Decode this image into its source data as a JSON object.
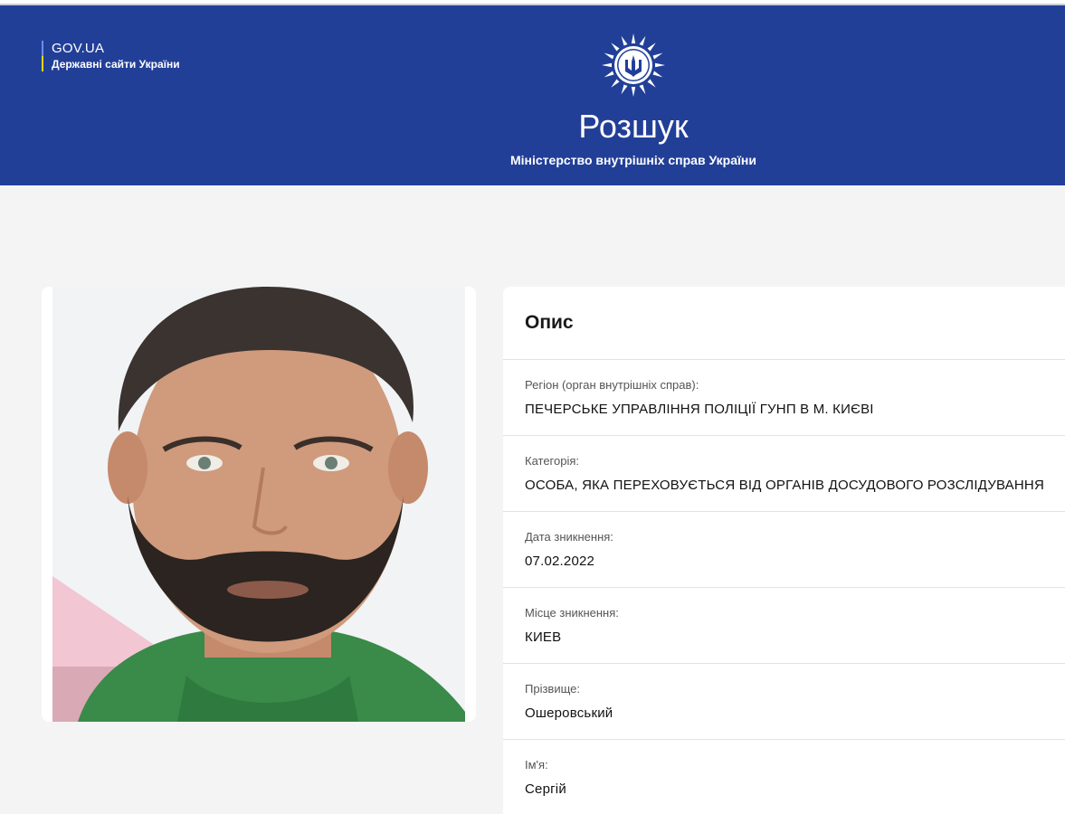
{
  "header": {
    "gov_title": "GOV.UA",
    "gov_subtitle": "Державні сайти України",
    "site_title": "Розшук",
    "site_subtitle": "Міністерство внутрішніх справ України"
  },
  "photo": {
    "icon": "person-photo"
  },
  "info": {
    "heading": "Опис",
    "rows": [
      {
        "label": "Регіон (орган внутрішніх справ):",
        "value": "ПЕЧЕРСЬКЕ УПРАВЛІННЯ ПОЛІЦІЇ ГУНП В М. КИЄВІ"
      },
      {
        "label": "Категорія:",
        "value": "ОСОБА, ЯКА ПЕРЕХОВУЄТЬСЯ ВІД ОРГАНІВ ДОСУДОВОГО РОЗСЛІДУВАННЯ"
      },
      {
        "label": "Дата зникнення:",
        "value": "07.02.2022"
      },
      {
        "label": "Місце зникнення:",
        "value": "КИЕВ"
      },
      {
        "label": "Прізвище:",
        "value": "Ошеровський"
      },
      {
        "label": "Ім'я:",
        "value": "Сергій"
      }
    ]
  },
  "colors": {
    "header_bg": "#223f98",
    "page_bg": "#f4f4f4",
    "card_bg": "#ffffff"
  }
}
